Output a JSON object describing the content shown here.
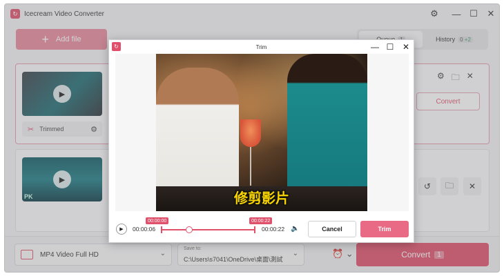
{
  "app": {
    "title": "Icecream Video Converter"
  },
  "toolbar": {
    "add_file_label": "Add file"
  },
  "tabs": [
    {
      "label": "Queue",
      "badge": "1"
    },
    {
      "label": "History",
      "badge_a": "0",
      "badge_b": "+2"
    }
  ],
  "queue": {
    "item1": {
      "status_label": "Trimmed",
      "convert_label": "Convert"
    }
  },
  "bottom_bar": {
    "format_label": "MP4 Video Full HD",
    "save_to_label": "Save to:",
    "save_path": "C:\\Users\\s7041\\OneDrive\\桌面\\測試",
    "convert_label": "Convert",
    "convert_count": "1"
  },
  "trim_dialog": {
    "title": "Trim",
    "caption": "修剪影片",
    "start_time": "00:00:06",
    "end_time": "00:00:22",
    "start_tag": "00:00:00",
    "end_tag": "00:00:22",
    "cancel_label": "Cancel",
    "trim_label": "Trim"
  },
  "watermark": "PK",
  "colors": {
    "accent": "#e0506b",
    "accent_light": "#e8889b",
    "history_badge_green": "#3aa063"
  }
}
